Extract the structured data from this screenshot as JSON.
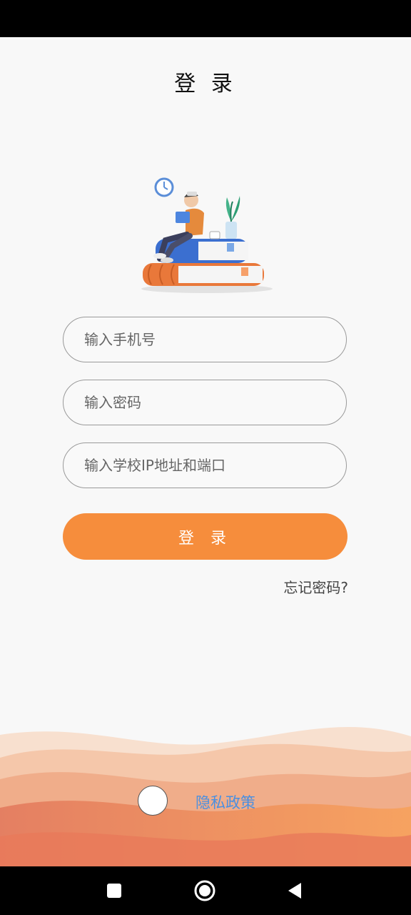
{
  "header": {
    "title": "登 录"
  },
  "form": {
    "phone_placeholder": "输入手机号",
    "password_placeholder": "输入密码",
    "school_placeholder": "输入学校IP地址和端口",
    "login_label": "登 录",
    "forgot_label": "忘记密码?"
  },
  "footer": {
    "privacy_label": "隐私政策"
  },
  "icons": {
    "illustration": "person-reading-on-books-illustration",
    "nav_recent": "square-icon",
    "nav_home": "circle-home-icon",
    "nav_back": "triangle-back-icon"
  },
  "colors": {
    "accent": "#f68d3c",
    "link": "#4a8fe0",
    "background": "#f8f8f8"
  }
}
